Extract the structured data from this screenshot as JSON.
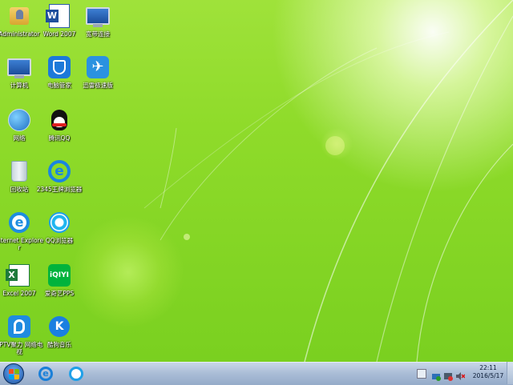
{
  "desktop": {
    "icons": [
      {
        "label": "Administrator",
        "icon": "user-folder-icon"
      },
      {
        "label": "Word 2007",
        "icon": "word-icon"
      },
      {
        "label": "宽带连接",
        "icon": "broadband-connection-icon"
      },
      {
        "label": "计算机",
        "icon": "computer-icon"
      },
      {
        "label": "电脑管家",
        "icon": "pc-manager-icon"
      },
      {
        "label": "迅雷极速版",
        "icon": "thunder-icon"
      },
      {
        "label": "网络",
        "icon": "network-icon"
      },
      {
        "label": "腾讯QQ",
        "icon": "qq-icon"
      },
      {
        "label": "回收站",
        "icon": "recycle-bin-icon"
      },
      {
        "label": "2345王牌浏览器",
        "icon": "2345-browser-icon"
      },
      {
        "label": "Internet Explorer",
        "icon": "internet-explorer-icon"
      },
      {
        "label": "QQ浏览器",
        "icon": "qq-browser-icon"
      },
      {
        "label": "Excel 2007",
        "icon": "excel-icon"
      },
      {
        "label": "爱奇艺PPS",
        "icon": "iqiyi-icon"
      },
      {
        "label": "PPTV聚力 网络电视",
        "icon": "pptv-icon"
      },
      {
        "label": "酷狗音乐",
        "icon": "kugou-icon"
      }
    ]
  },
  "taskbar": {
    "start_icon": "windows-start-icon",
    "pinned": [
      {
        "icon": "internet-explorer-icon"
      },
      {
        "icon": "qq-browser-icon"
      }
    ],
    "tray": [
      {
        "icon": "keyboard-icon"
      },
      {
        "icon": "network-tray-icon"
      },
      {
        "icon": "security-tray-icon"
      },
      {
        "icon": "volume-muted-icon"
      }
    ],
    "clock": {
      "time": "22:11",
      "date": "2016/5/17"
    }
  },
  "colors": {
    "desktop_green": "#8fdb2a",
    "taskbar": "#a9bcd6"
  }
}
